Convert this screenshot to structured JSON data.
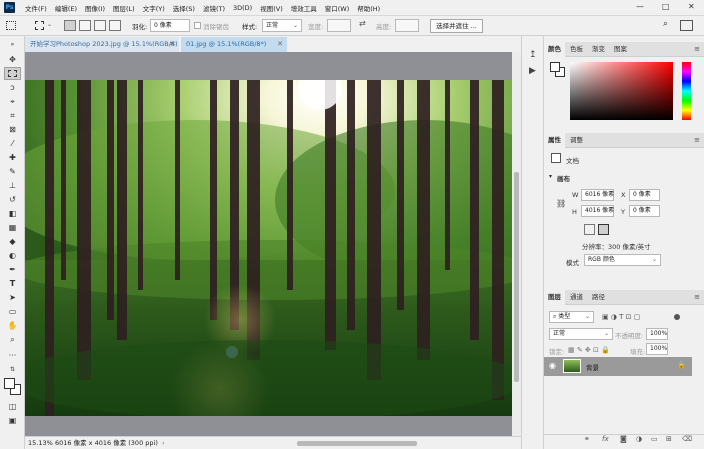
{
  "menubar": {
    "logo": "Ps",
    "items": [
      "文件(F)",
      "编辑(E)",
      "图像(I)",
      "图层(L)",
      "文字(Y)",
      "选择(S)",
      "滤镜(T)",
      "3D(D)",
      "视图(V)",
      "增效工具",
      "窗口(W)",
      "帮助(H)"
    ],
    "minimize": "—",
    "maximize": "□",
    "close": "✕"
  },
  "options": {
    "feather_label": "羽化:",
    "feather_value": "0 像素",
    "antialias_label": "消除锯齿",
    "style_label": "样式:",
    "style_value": "正常",
    "width_label": "宽度:",
    "height_label": "高度:",
    "select_mask_button": "选择并遮住 ..."
  },
  "tabs": [
    {
      "label": "开始学习Photoshop 2023.jpg @ 15.1%(RGB/8)",
      "close": "✕"
    },
    {
      "label": "01.jpg @ 15.1%(RGB/8*)",
      "close": "✕"
    }
  ],
  "status": {
    "zoom": "15.13%",
    "doc_info": "6016 像素 x 4016 像素 (300 ppi)"
  },
  "color_panel": {
    "tabs": [
      "颜色",
      "色板",
      "渐变",
      "图案"
    ]
  },
  "properties_panel": {
    "tabs": [
      "属性",
      "调整"
    ],
    "doc_label": "文档",
    "canvas_label": "画布",
    "w_label": "W",
    "w_value": "6016 像素",
    "h_label": "H",
    "h_value": "4016 像素",
    "x_label": "X",
    "x_value": "0 像素",
    "y_label": "Y",
    "y_value": "0 像素",
    "resolution": "分辨率：300 像素/英寸",
    "mode_label": "模式",
    "mode_value": "RGB 颜色"
  },
  "layers_panel": {
    "tabs": [
      "图层",
      "通道",
      "路径"
    ],
    "filter_kind": "类型",
    "blend_mode": "正常",
    "opacity_label": "不透明度:",
    "opacity_value": "100%",
    "lock_label": "锁定:",
    "fill_label": "填充:",
    "fill_value": "100%",
    "layer_name": "背景"
  },
  "colors": {
    "accent_tab": "#c3dbef",
    "layer_selected": "#9a9a9a",
    "panel_bg": "#f0f0f0"
  }
}
